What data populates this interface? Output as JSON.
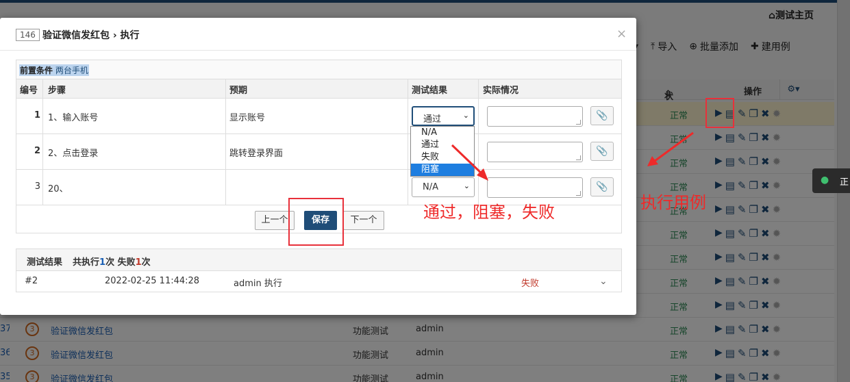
{
  "background": {
    "home_link": "测试主页",
    "toolbar": [
      {
        "icon": "caret-down-icon",
        "label": ""
      },
      {
        "icon": "upload-icon",
        "label": "导入"
      },
      {
        "icon": "plus-circle-icon",
        "label": "批量添加"
      },
      {
        "icon": "plus-icon",
        "label": "建用例"
      }
    ],
    "columns": {
      "status": "状态",
      "actions": "操作"
    },
    "status_rows": [
      "正常",
      "正常",
      "正常",
      "正常",
      "正常",
      "正常",
      "正常",
      "正常",
      "正常"
    ],
    "case_rows": [
      {
        "id": "37",
        "priority": "3",
        "title": "验证微信发红包",
        "type": "功能测试",
        "user": "admin",
        "status": "正常"
      },
      {
        "id": "36",
        "priority": "3",
        "title": "验证微信发红包",
        "type": "功能测试",
        "user": "admin",
        "status": "正常"
      },
      {
        "id": "35",
        "priority": "3",
        "title": "验证微信发红包",
        "type": "功能测试",
        "user": "admin",
        "status": "正常"
      }
    ]
  },
  "chat_chip": {
    "text": "正"
  },
  "modal": {
    "case_id": "146",
    "title": "验证微信发红包 › 执行",
    "precondition_label": "前置条件",
    "precondition_value": "两台手机",
    "headers": {
      "no": "编号",
      "step": "步骤",
      "expect": "预期",
      "result": "测试结果",
      "actual": "实际情况"
    },
    "steps": [
      {
        "no": "1",
        "desc": "1、输入账号",
        "expect": "显示账号",
        "result": "通过"
      },
      {
        "no": "2",
        "desc": "2、点击登录",
        "expect": "跳转登录界面",
        "result": ""
      },
      {
        "no": "3",
        "desc": "20、",
        "expect": "",
        "result": "N/A"
      }
    ],
    "dropdown_options": [
      "N/A",
      "通过",
      "失败",
      "阻塞"
    ],
    "dropdown_highlighted": "阻塞",
    "buttons": {
      "prev": "上一个",
      "save": "保存",
      "next": "下一个"
    },
    "results": {
      "label": "测试结果",
      "summary_prefix": "共执行",
      "exec_count": "1",
      "summary_mid": "次 失败",
      "fail_count": "1",
      "summary_suffix": "次",
      "runs": [
        {
          "id": "#2",
          "time": "2022-02-25 11:44:28",
          "actor": "admin 执行",
          "result": "失败"
        }
      ]
    }
  },
  "annotations": {
    "results_note": "通过，阻塞，失败",
    "execute_note": "执行用例",
    "color": "#ee2a2a"
  }
}
